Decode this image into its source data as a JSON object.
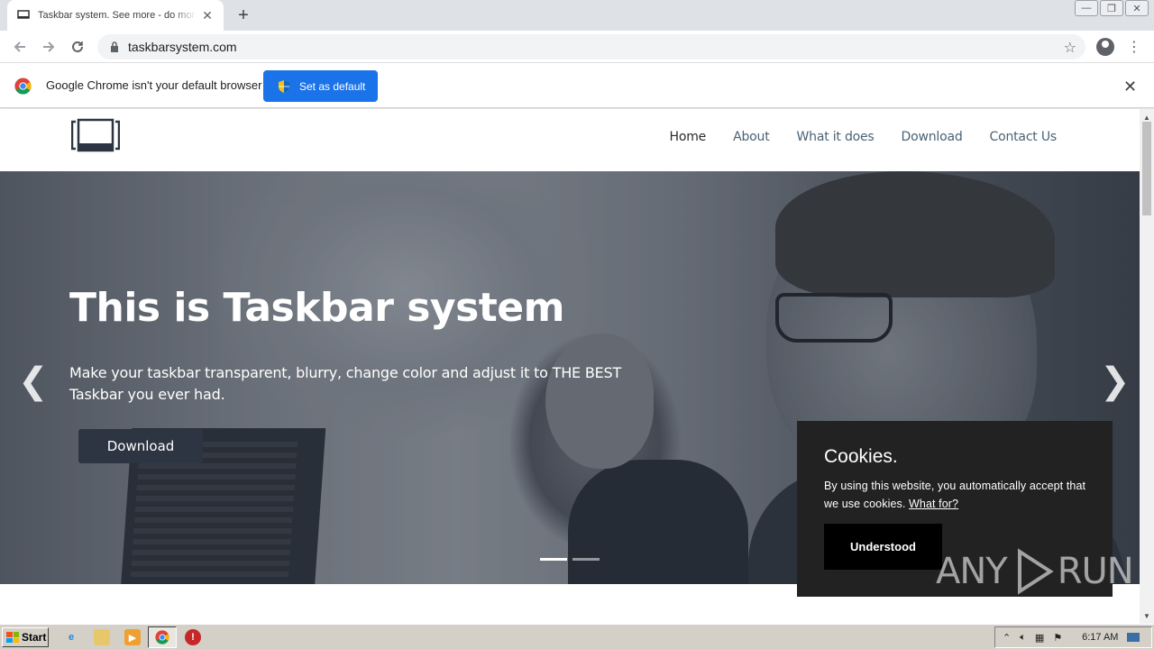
{
  "browser": {
    "tab_title": "Taskbar system. See more - do more",
    "tab_close": "✕",
    "new_tab": "+",
    "url": "taskbarsystem.com",
    "window_buttons": [
      "—",
      "❐",
      "✕"
    ]
  },
  "infobar": {
    "message": "Google Chrome isn't your default browser",
    "button_label": "Set as default",
    "close": "✕"
  },
  "site": {
    "nav": [
      {
        "label": "Home",
        "active": true
      },
      {
        "label": "About"
      },
      {
        "label": "What it does"
      },
      {
        "label": "Download"
      },
      {
        "label": "Contact Us"
      }
    ],
    "hero": {
      "title": "This is Taskbar system",
      "subtitle": "Make your taskbar transparent, blurry, change color and adjust it to THE BEST Taskbar you ever had.",
      "button_label": "Download",
      "prev_arrow": "❮",
      "next_arrow": "❯",
      "slides": 2,
      "active_slide": 1
    }
  },
  "cookie": {
    "title": "Cookies.",
    "text": "By using this website, you automatically accept that we use cookies.",
    "link": "What for?",
    "button_label": "Understood"
  },
  "watermark": {
    "left": "ANY",
    "right": "RUN"
  },
  "taskbar": {
    "start_label": "Start",
    "clock": "6:17 AM"
  },
  "colors": {
    "accent_blue": "#1a73e8",
    "hero_button": "#2d3442",
    "nav_link": "#4a6275",
    "cookie_bg": "#222222"
  }
}
